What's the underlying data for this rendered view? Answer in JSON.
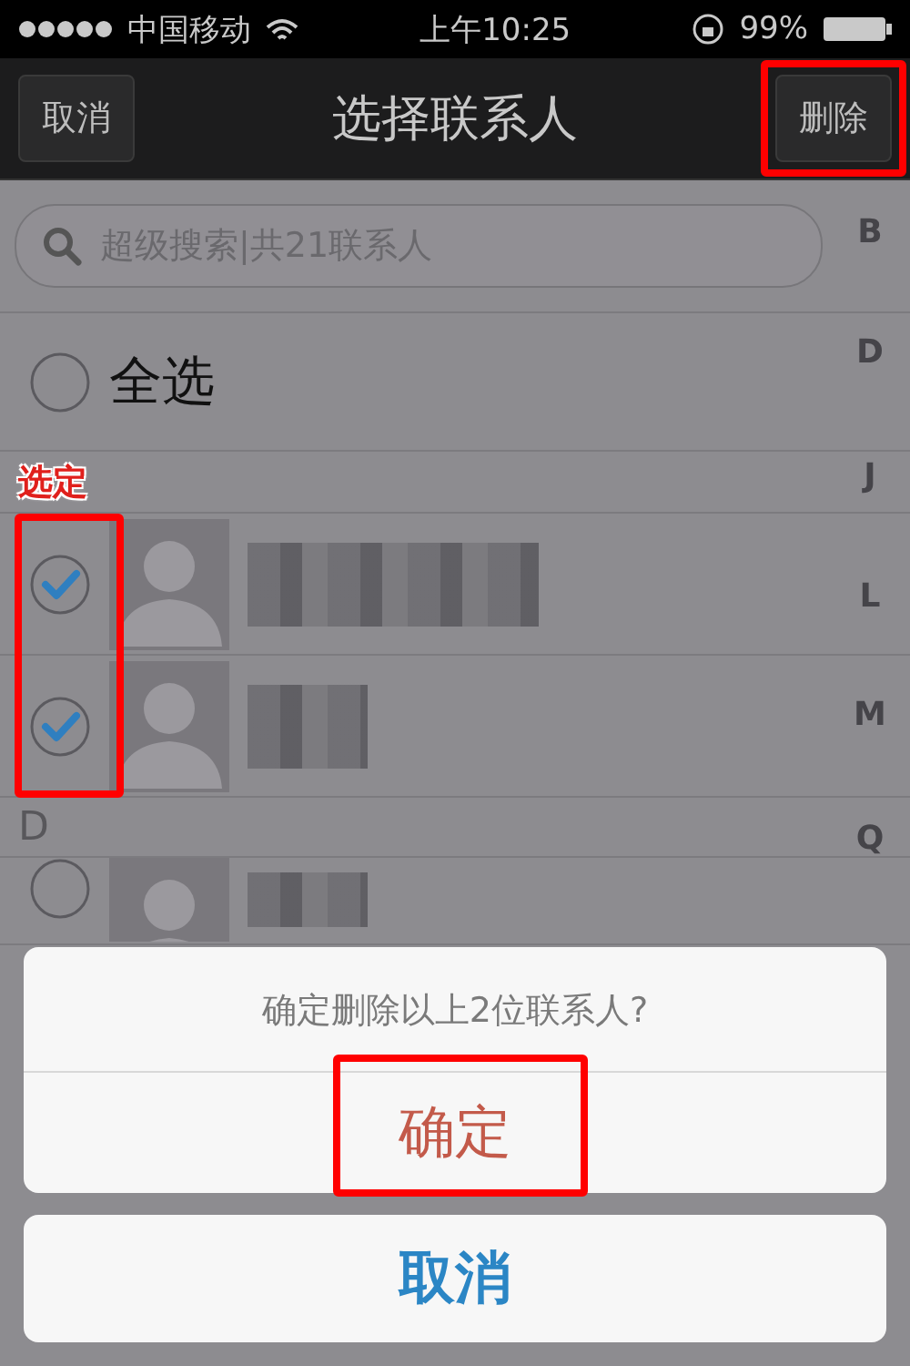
{
  "status_bar": {
    "carrier": "中国移动",
    "time": "上午10:25",
    "battery": "99%"
  },
  "nav": {
    "cancel": "取消",
    "title": "选择联系人",
    "action": {
      "label": "删除",
      "highlighted": true
    }
  },
  "search": {
    "placeholder": "超级搜索|共21联系人"
  },
  "select_all": {
    "label": "全选",
    "checked": false
  },
  "annotation": "选定",
  "groups": [
    {
      "highlighted": true,
      "contacts": [
        {
          "checked": true
        },
        {
          "checked": true
        }
      ]
    },
    {
      "header": "D",
      "highlighted": false,
      "contacts": [
        {
          "checked": false
        }
      ]
    }
  ],
  "index": [
    "B",
    "D",
    "J",
    "L",
    "M",
    "Q"
  ],
  "sheet": {
    "message": "确定删除以上2位联系人?",
    "confirm": {
      "label": "确定",
      "highlighted": true
    },
    "cancel": "取消"
  }
}
